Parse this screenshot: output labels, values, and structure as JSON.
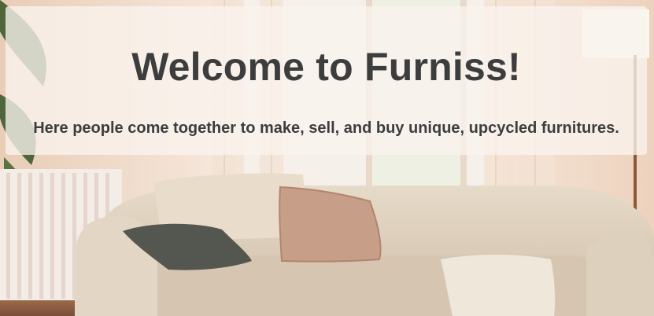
{
  "hero": {
    "title": "Welcome to Furniss!",
    "subtitle": "Here people come together to make, sell, and buy unique, upcycled furnitures.",
    "image": "living-room-sofa-photo"
  },
  "colors": {
    "text": "#3d3d3d",
    "wall": "#f1dccb",
    "sofa": "#dfd1bd",
    "pillow_dark": "#545650",
    "pillow_rose": "#c6a089",
    "throw": "#efe7da"
  }
}
